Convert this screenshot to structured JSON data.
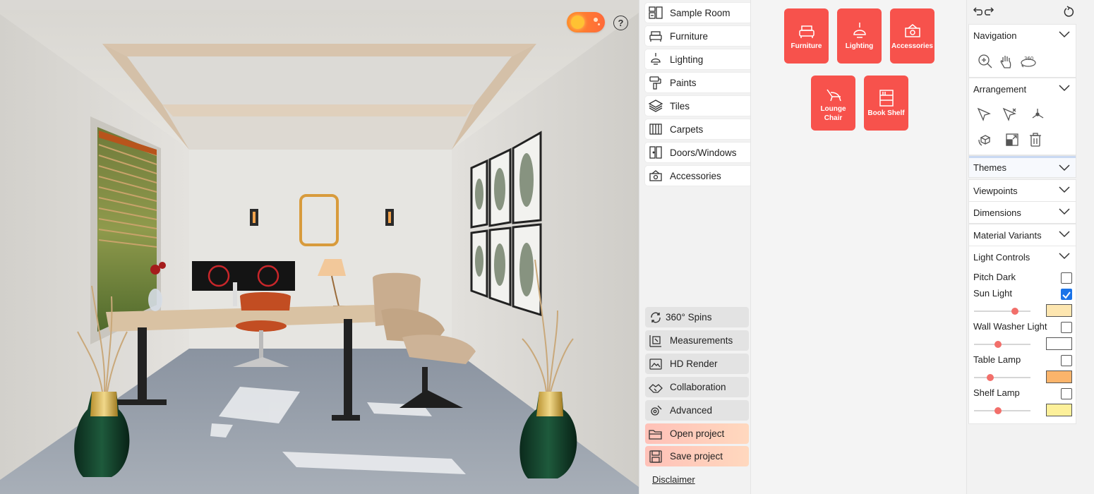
{
  "viewport": {
    "scene_label": "3D office room viewport",
    "help_label": "?"
  },
  "categories": [
    {
      "label": "Sample Room",
      "icon": "sample-room-icon"
    },
    {
      "label": "Furniture",
      "icon": "furniture-icon"
    },
    {
      "label": "Lighting",
      "icon": "lighting-icon"
    },
    {
      "label": "Paints",
      "icon": "paints-icon"
    },
    {
      "label": "Tiles",
      "icon": "tiles-icon"
    },
    {
      "label": "Carpets",
      "icon": "carpets-icon"
    },
    {
      "label": "Doors/Windows",
      "icon": "doors-windows-icon"
    },
    {
      "label": "Accessories",
      "icon": "accessories-icon"
    }
  ],
  "tools": [
    {
      "label": "360° Spins",
      "icon": "spin-icon"
    },
    {
      "label": "Measurements",
      "icon": "measurements-icon"
    },
    {
      "label": "HD Render",
      "icon": "hd-render-icon"
    },
    {
      "label": "Collaboration",
      "icon": "collaboration-icon"
    },
    {
      "label": "Advanced",
      "icon": "advanced-icon"
    },
    {
      "label": "Open project",
      "icon": "folder-icon"
    },
    {
      "label": "Save project",
      "icon": "save-icon"
    }
  ],
  "disclaimer": "Disclaimer",
  "products": [
    {
      "label": "Furniture",
      "icon": "furniture-icon"
    },
    {
      "label": "Lighting",
      "icon": "lighting-icon"
    },
    {
      "label": "Accessories",
      "icon": "accessories-icon"
    },
    {
      "label": "Lounge Chair",
      "icon": "lounge-chair-icon"
    },
    {
      "label": "Book Shelf",
      "icon": "book-shelf-icon"
    }
  ],
  "panel": {
    "sections": {
      "navigation": "Navigation",
      "arrangement": "Arrangement",
      "themes": "Themes",
      "viewpoints": "Viewpoints",
      "dimensions": "Dimensions",
      "material_variants": "Material Variants",
      "light_controls": "Light Controls"
    },
    "nav_360_label": "360"
  },
  "light_controls": [
    {
      "label": "Pitch Dark",
      "checked": false
    },
    {
      "label": "Sun Light",
      "checked": true,
      "level": 0.72,
      "color": "#fde6b0"
    },
    {
      "label": "Wall Washer Light",
      "checked": false,
      "level": 0.42,
      "color": "#ffffff"
    },
    {
      "label": "Table Lamp",
      "checked": false,
      "level": 0.29,
      "color": "#fbb46b"
    },
    {
      "label": "Shelf Lamp",
      "checked": false,
      "level": 0.42,
      "color": "#fdf09a"
    }
  ],
  "colors": {
    "accent": "#f7524c",
    "check": "#1a73e8",
    "slider_thumb": "#f26f6a"
  }
}
